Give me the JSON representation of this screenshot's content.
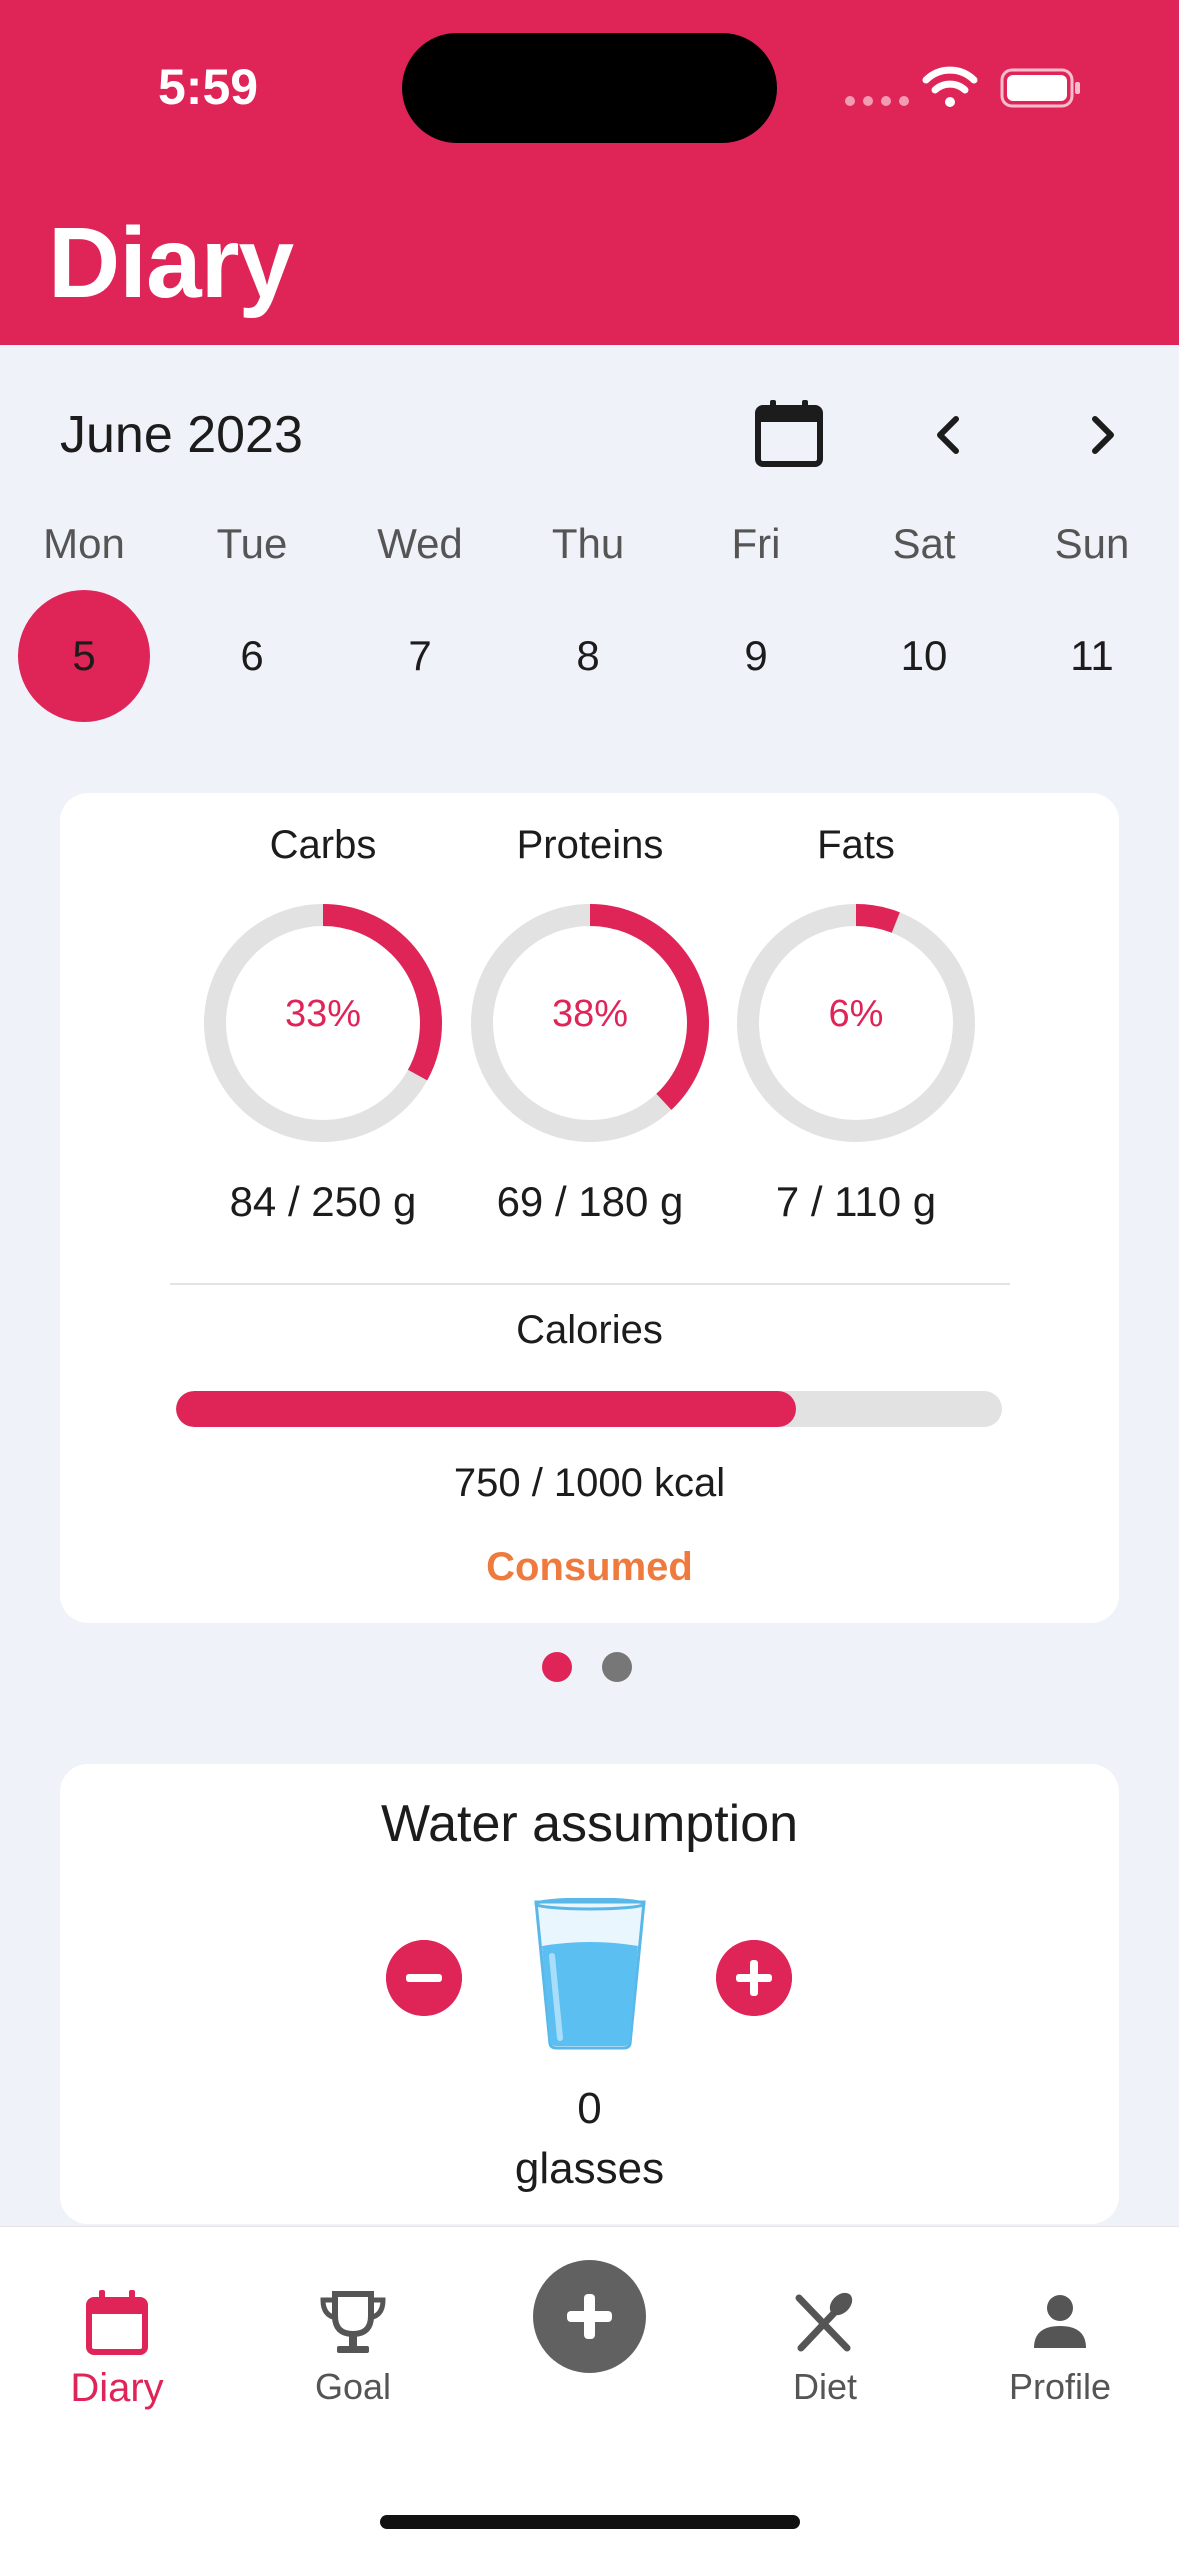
{
  "status_bar": {
    "time": "5:59"
  },
  "header": {
    "title": "Diary"
  },
  "calendar": {
    "month": "June 2023",
    "days": [
      {
        "name": "Mon",
        "num": "5",
        "selected": true
      },
      {
        "name": "Tue",
        "num": "6"
      },
      {
        "name": "Wed",
        "num": "7"
      },
      {
        "name": "Thu",
        "num": "8"
      },
      {
        "name": "Fri",
        "num": "9"
      },
      {
        "name": "Sat",
        "num": "10"
      },
      {
        "name": "Sun",
        "num": "11"
      }
    ]
  },
  "macros": [
    {
      "label": "Carbs",
      "percent_text": "33%",
      "fraction": 0.33,
      "amount": "84 / 250 g"
    },
    {
      "label": "Proteins",
      "percent_text": "38%",
      "fraction": 0.38,
      "amount": "69 / 180 g"
    },
    {
      "label": "Fats",
      "percent_text": "6%",
      "fraction": 0.06,
      "amount": "7 / 110 g"
    }
  ],
  "calories": {
    "label": "Calories",
    "amount": "750 / 1000 kcal",
    "fraction": 0.75,
    "status": "Consumed"
  },
  "pager": {
    "count": 2,
    "active": 0
  },
  "water": {
    "title": "Water assumption",
    "count": "0",
    "unit": "glasses"
  },
  "tabs": [
    {
      "label": "Diary",
      "icon": "calendar-icon",
      "active": true
    },
    {
      "label": "Goal",
      "icon": "trophy-icon"
    },
    {
      "label": "",
      "icon": "plus-icon"
    },
    {
      "label": "Diet",
      "icon": "fork-knife-icon"
    },
    {
      "label": "Profile",
      "icon": "person-icon"
    }
  ],
  "colors": {
    "accent": "#DF2558",
    "consumed": "#EF7A3E",
    "ring_track": "#E2E2E2",
    "background": "#EFF2F8"
  }
}
